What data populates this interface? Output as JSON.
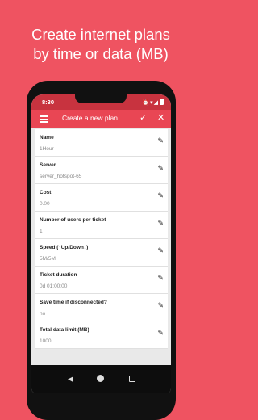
{
  "headline": {
    "line1": "Create internet plans",
    "line2": "by time or data (MB)"
  },
  "status_bar": {
    "time": "8:30",
    "icons": [
      "notification-icon",
      "settings-icon",
      "sync-icon",
      "alarm-icon",
      "wifi-icon",
      "signal-icon",
      "battery-icon"
    ]
  },
  "app_bar": {
    "title": "Create a new plan",
    "confirm_icon": "checkmark-icon",
    "close_icon": "close-icon"
  },
  "fields": [
    {
      "label": "Name",
      "value": "1Hour"
    },
    {
      "label": "Server",
      "value": "server_hotspot-65"
    },
    {
      "label": "Cost",
      "value": "0.00"
    },
    {
      "label": "Number of users per ticket",
      "value": "1"
    },
    {
      "label": "Speed (↑Up/Down↓)",
      "value": "5M/5M"
    },
    {
      "label": "Ticket duration",
      "value": "0d 01:00:00"
    },
    {
      "label": "Save time if disconnected?",
      "value": "no"
    },
    {
      "label": "Total data limit (MB)",
      "value": "1000"
    }
  ],
  "nav_bar": {
    "icons": [
      "back-icon",
      "home-icon",
      "recents-icon"
    ]
  },
  "colors": {
    "background": "#ef5361",
    "app_bar": "#e94654",
    "status_bar": "#c8333f"
  }
}
